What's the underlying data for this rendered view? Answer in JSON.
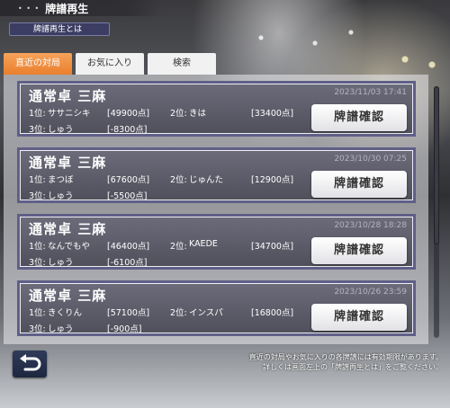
{
  "header": {
    "title": "牌譜再生"
  },
  "help_button": {
    "label": "牌譜再生とは"
  },
  "tabs": [
    {
      "label": "直近の対局",
      "active": true
    },
    {
      "label": "お気に入り",
      "active": false
    },
    {
      "label": "検索",
      "active": false
    }
  ],
  "confirm_label": "牌譜確認",
  "records": [
    {
      "title": "通常卓 三麻",
      "date": "2023/11/03 17:41",
      "p1_rank": "1位:",
      "p1_name": "ササニシキ",
      "p1_score": "[49900点]",
      "p2_rank": "2位:",
      "p2_name": "きは",
      "p2_score": "[33400点]",
      "p3_rank": "3位:",
      "p3_name": "しゅう",
      "p3_score": "[-8300点]"
    },
    {
      "title": "通常卓 三麻",
      "date": "2023/10/30 07:25",
      "p1_rank": "1位:",
      "p1_name": "まつぼ",
      "p1_score": "[67600点]",
      "p2_rank": "2位:",
      "p2_name": "じゅんた",
      "p2_score": "[12900点]",
      "p3_rank": "3位:",
      "p3_name": "しゅう",
      "p3_score": "[-5500点]"
    },
    {
      "title": "通常卓 三麻",
      "date": "2023/10/28 18:28",
      "p1_rank": "1位:",
      "p1_name": "なんでもや",
      "p1_score": "[46400点]",
      "p2_rank": "2位:",
      "p2_name": "KAEDE",
      "p2_score": "[34700点]",
      "p3_rank": "3位:",
      "p3_name": "しゅう",
      "p3_score": "[-6100点]"
    },
    {
      "title": "通常卓 三麻",
      "date": "2023/10/26 23:59",
      "p1_rank": "1位:",
      "p1_name": "きくりん",
      "p1_score": "[57100点]",
      "p2_rank": "2位:",
      "p2_name": "インスパ",
      "p2_score": "[16800点]",
      "p3_rank": "3位:",
      "p3_name": "しゅう",
      "p3_score": "[-900点]"
    }
  ],
  "notice": {
    "line1": "直近の対局やお気に入りの各牌譜には有効期限があります。",
    "line2": "詳しくは画面左上の「牌譜再生とは」をご覧ください。"
  },
  "icons": {
    "back": "back-arrow-icon"
  }
}
